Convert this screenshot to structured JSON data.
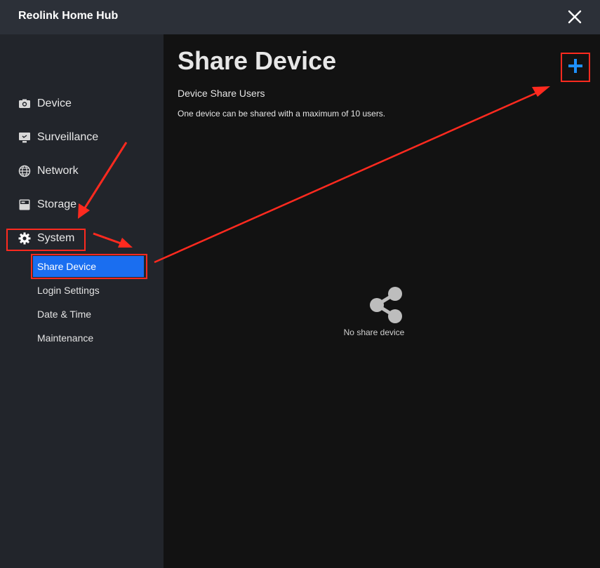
{
  "window": {
    "title": "Reolink Home Hub"
  },
  "sidebar": {
    "items": [
      {
        "label": "Device",
        "icon": "camera-icon"
      },
      {
        "label": "Surveillance",
        "icon": "monitor-icon"
      },
      {
        "label": "Network",
        "icon": "globe-icon"
      },
      {
        "label": "Storage",
        "icon": "storage-icon"
      },
      {
        "label": "System",
        "icon": "gear-icon"
      }
    ],
    "system_subitems": [
      {
        "label": "Share Device",
        "active": true
      },
      {
        "label": "Login Settings"
      },
      {
        "label": "Date & Time"
      },
      {
        "label": "Maintenance"
      }
    ]
  },
  "main": {
    "page_title": "Share Device",
    "section_title": "Device Share Users",
    "section_desc": "One device can be shared with a maximum of 10 users.",
    "empty_text": "No share device"
  },
  "colors": {
    "accent": "#1a6ef0",
    "add_icon": "#1e90ff",
    "annotation": "#ff2a1f"
  }
}
